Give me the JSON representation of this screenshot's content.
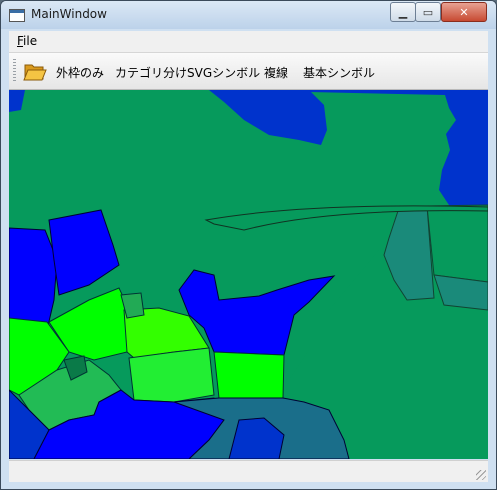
{
  "window": {
    "title": "MainWindow"
  },
  "menubar": {
    "file": "File",
    "file_rest": "ile",
    "file_mnemonic": "F"
  },
  "toolbar": {
    "buttons": [
      "外枠のみ",
      "カテゴリ分け",
      "SVGシンボル",
      "複線",
      "基本シンボル"
    ]
  },
  "colors": {
    "green_region": "#069a5c",
    "blue_region": "#0033cc",
    "bright_blue": "#0000ff",
    "lime": "#00ff00",
    "teal": "#1a8a7a"
  }
}
